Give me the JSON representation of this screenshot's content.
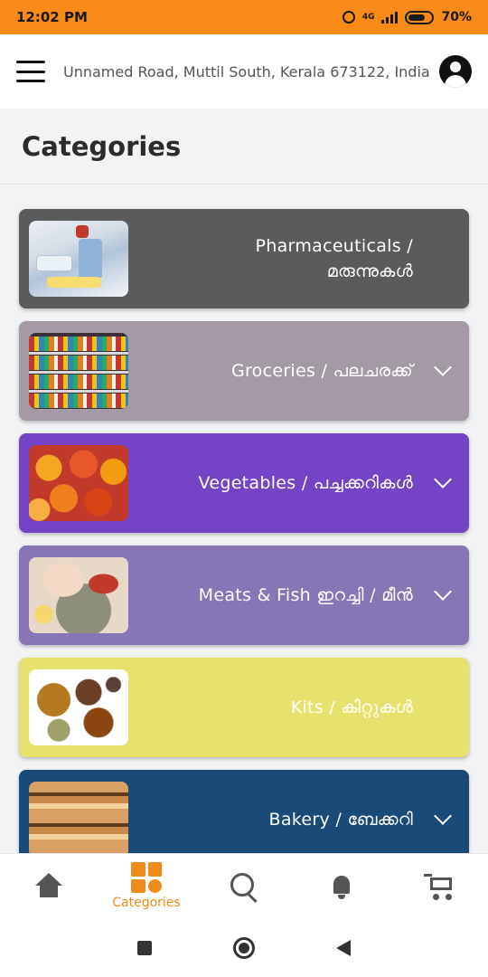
{
  "status_bar": {
    "time": "12:02 PM",
    "network": "4G",
    "battery": "70%"
  },
  "header": {
    "address": "Unnamed Road, Muttil South, Kerala 673122, India",
    "menu_icon": "hamburger-menu-icon",
    "profile_icon": "account-circle-icon"
  },
  "page": {
    "title": "Categories"
  },
  "categories": [
    {
      "line1": "Pharmaceuticals /",
      "line2": "മരുന്നുകൾ",
      "color": "#595b5c",
      "expandable": false
    },
    {
      "line1": "Groceries / പലചരക്ക്",
      "line2": "",
      "color": "#a39aa5",
      "expandable": true
    },
    {
      "line1": "Vegetables / പച്ചക്കറികൾ",
      "line2": "",
      "color": "#7544c6",
      "expandable": true
    },
    {
      "line1": "Meats & Fish  ഇറച്ചി /  മീൻ",
      "line2": "",
      "color": "#8676b6",
      "expandable": true
    },
    {
      "line1": "Kits / കിറ്റുകൾ",
      "line2": "",
      "color": "#e7e26d",
      "expandable": false
    },
    {
      "line1": "Bakery  / ബേക്കറി",
      "line2": "",
      "color": "#1a4a78",
      "expandable": true
    }
  ],
  "bottom_nav": [
    {
      "label": "",
      "icon": "home-icon",
      "active": false
    },
    {
      "label": "Categories",
      "icon": "categories-grid-icon",
      "active": true
    },
    {
      "label": "",
      "icon": "search-icon",
      "active": false
    },
    {
      "label": "",
      "icon": "bell-icon",
      "active": false
    },
    {
      "label": "",
      "icon": "cart-icon",
      "active": false
    }
  ],
  "colors": {
    "accent": "#f38b1c",
    "status_bar": "#f88a17",
    "icon_gray": "#555555"
  }
}
